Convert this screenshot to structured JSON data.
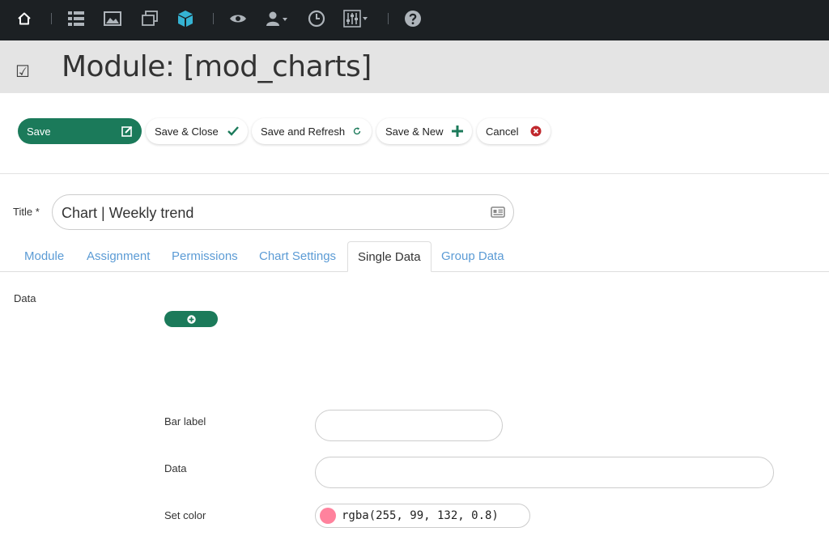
{
  "toolbar_icons": [
    "home-icon",
    "list-icon",
    "image-icon",
    "layers-icon",
    "cube-icon",
    "eye-icon",
    "user-dropdown-icon",
    "clock-icon",
    "sliders-dropdown-icon",
    "help-icon"
  ],
  "header": {
    "title": "Module: [mod_charts]",
    "icon": "checkbox-icon"
  },
  "actions": {
    "save": "Save",
    "save_close": "Save & Close",
    "save_refresh": "Save and Refresh",
    "save_new": "Save & New",
    "cancel": "Cancel"
  },
  "title_field": {
    "label": "Title *",
    "value": "Chart | Weekly trend"
  },
  "tabs": [
    {
      "label": "Module"
    },
    {
      "label": "Assignment"
    },
    {
      "label": "Permissions"
    },
    {
      "label": "Chart Settings"
    },
    {
      "label": "Single Data",
      "active": true
    },
    {
      "label": "Group Data"
    }
  ],
  "data_section": {
    "label": "Data"
  },
  "fields": {
    "bar_label": {
      "label": "Bar label",
      "value": ""
    },
    "data": {
      "label": "Data",
      "value": ""
    },
    "set_color": {
      "label": "Set color",
      "value": "rgba(255, 99, 132, 0.8)"
    }
  },
  "colors": {
    "accent": "#1b7a5a",
    "topbar": "#1c2023",
    "header_bg": "#e4e4e4",
    "tab_link": "#5b9bd5",
    "cancel_red": "#c0282d"
  }
}
